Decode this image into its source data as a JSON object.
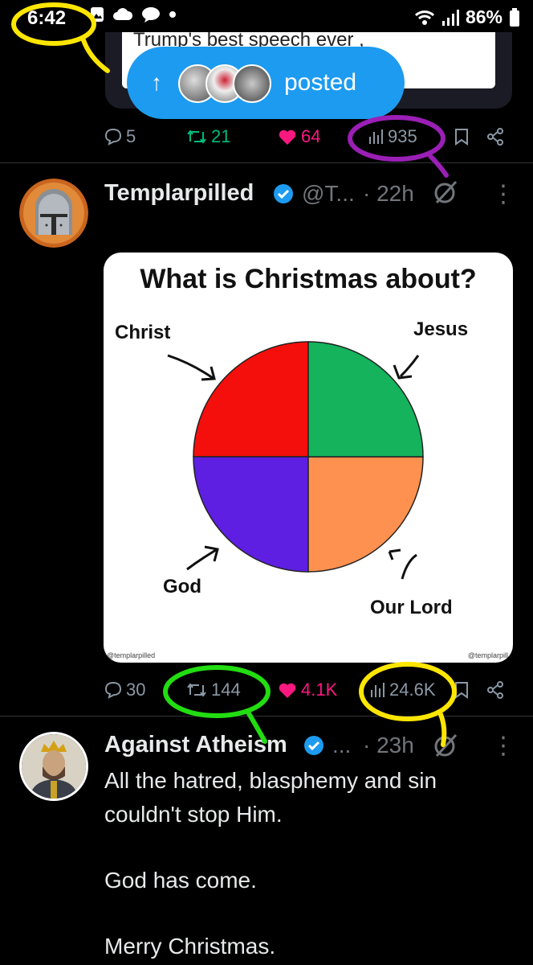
{
  "status_bar": {
    "time": "6:42",
    "battery": "86%"
  },
  "prev_tweet": {
    "quoted_text": "Trump's best speech ever ,",
    "posted_label": "posted",
    "actions": {
      "replies": "5",
      "reposts": "21",
      "likes": "64",
      "views": "935"
    }
  },
  "tweet1": {
    "name": "Templarpilled",
    "handle": "@T...",
    "time": "· 22h",
    "meme": {
      "title": "What is Christmas about?",
      "watermark_left": "@templarpilled",
      "watermark_right": "@templarpill"
    },
    "actions": {
      "replies": "30",
      "reposts": "144",
      "likes": "4.1K",
      "views": "24.6K"
    }
  },
  "chart_data": {
    "type": "pie",
    "title": "What is Christmas about?",
    "categories": [
      "Christ",
      "Jesus",
      "Our Lord",
      "God"
    ],
    "values": [
      25,
      25,
      25,
      25
    ],
    "colors": [
      "#f40f0c",
      "#14b35c",
      "#ff9150",
      "#5e1fe2"
    ]
  },
  "tweet2": {
    "name": "Against Atheism",
    "handle": "...",
    "time": "· 23h",
    "lines": [
      "All the hatred, blasphemy and sin couldn't stop Him.",
      "God has come.",
      "Merry Christmas."
    ]
  },
  "colors": {
    "accent": "#1d9bf0",
    "repost": "#00ba7c",
    "like": "#f91880",
    "annotation_yellow": "#ffe600",
    "annotation_purple": "#9a1fb5",
    "annotation_green": "#22dd11"
  }
}
